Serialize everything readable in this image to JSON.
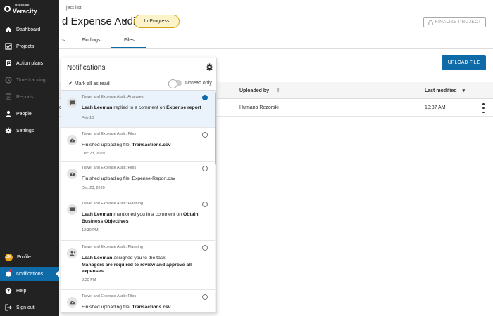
{
  "brand": {
    "small": "CaseWare",
    "big": "Veracity"
  },
  "nav": [
    {
      "label": "Dashboard",
      "icon": "home-icon"
    },
    {
      "label": "Projects",
      "icon": "checkbox-icon"
    },
    {
      "label": "Action plans",
      "icon": "flag-icon"
    },
    {
      "label": "Time tracking",
      "icon": "clock-icon"
    },
    {
      "label": "Reports",
      "icon": "report-icon"
    },
    {
      "label": "People",
      "icon": "person-icon"
    },
    {
      "label": "Settings",
      "icon": "gear-icon"
    }
  ],
  "nav_bottom": {
    "profile": "Profile",
    "profile_initials": "JM",
    "notifications": "Notifications",
    "help": "Help",
    "signout": "Sign out"
  },
  "header": {
    "breadcrumb": "ject list",
    "title": "d Expense Audit",
    "status": "In Progress",
    "finalize": "FINALIZE PROJECT",
    "tabs": [
      "rs",
      "Findings",
      "Files"
    ],
    "upload": "UPLOAD FILE"
  },
  "table": {
    "col_uploaded_by": "Uploaded by",
    "col_modified": "Last modified",
    "row": {
      "prefix": "e",
      "uploaded_by": "Humana Rezorski",
      "modified": "10:37 AM"
    }
  },
  "notifications": {
    "title": "Notifications",
    "mark_all": "Mark all as read",
    "unread_only": "Unread only",
    "items": [
      {
        "context": "Travel and Expense Audit: Analyses",
        "p1": "Leah Leeman",
        "p2": " replied to a comment on ",
        "p3": "Expense report",
        "time": "Feb 10"
      },
      {
        "context": "Travel and Expense Audit: Files",
        "p1": "",
        "p2": "Finished uploading file: ",
        "p3": "Transactions.csv",
        "time": "Dec 23, 2020"
      },
      {
        "context": "Travel and Expense Audit: Files",
        "p1": "",
        "p2": "Finished uploading file: Expense-Report.csv",
        "p3": "",
        "time": "Dec 23, 2020"
      },
      {
        "context": "Travel and Expense Audit: Planning",
        "p1": "Leah Leeman",
        "p2": " mentioned you in a comment on ",
        "p3": "Obtain Business Objectives",
        "time": "12:30 PM"
      },
      {
        "context": "Travel and Expense Audit: Planning",
        "p1": "Leah Leeman",
        "p2": " assigned you to the task: ",
        "p3": "Managers are required to review and approve all expenses",
        "time": "3:30 PM"
      },
      {
        "context": "Travel and Expense Audit: Files",
        "p1": "",
        "p2": "Finished uploading file: ",
        "p3": "Transactions.csv",
        "time": ""
      }
    ]
  }
}
